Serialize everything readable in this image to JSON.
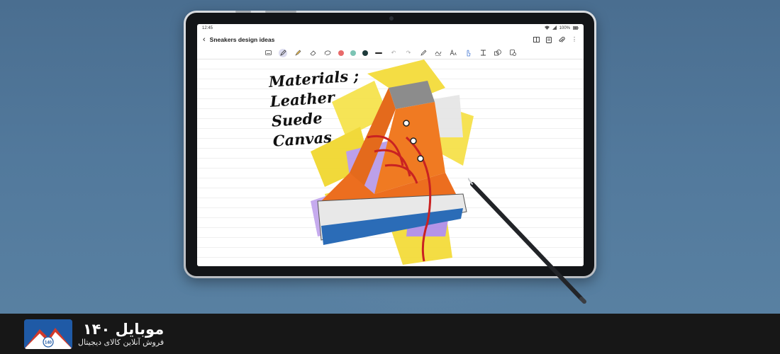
{
  "status_bar": {
    "time": "12:45",
    "battery": "100%"
  },
  "note": {
    "title": "Sneakers design ideas",
    "back_icon": "chevron-left-icon"
  },
  "header_actions": [
    "book-view-icon",
    "pages-icon",
    "attach-icon",
    "more-vert-icon"
  ],
  "toolbar": {
    "tools": [
      "keyboard-icon",
      "pen-icon",
      "highlighter-icon",
      "eraser-icon",
      "lasso-icon"
    ],
    "colors": [
      "#e86a6a",
      "#7cc4b4",
      "#1d3a3a"
    ],
    "actions": [
      "line-thickness-icon",
      "undo-icon",
      "redo-icon",
      "pen-tool-icon",
      "shape-icon",
      "text-size-icon",
      "touch-draw-icon",
      "text-box-icon",
      "insert-shape-icon",
      "tag-icon"
    ]
  },
  "handwriting": [
    "Materials ;",
    "Leather",
    "Suede",
    "Canvas"
  ],
  "brand": {
    "name": "موبایل ۱۴۰",
    "tagline": "فروش آنلاین کالای دیجیتال",
    "logo_text": "140",
    "colors": {
      "red": "#d23a2a",
      "blue": "#1f5aa6"
    }
  }
}
